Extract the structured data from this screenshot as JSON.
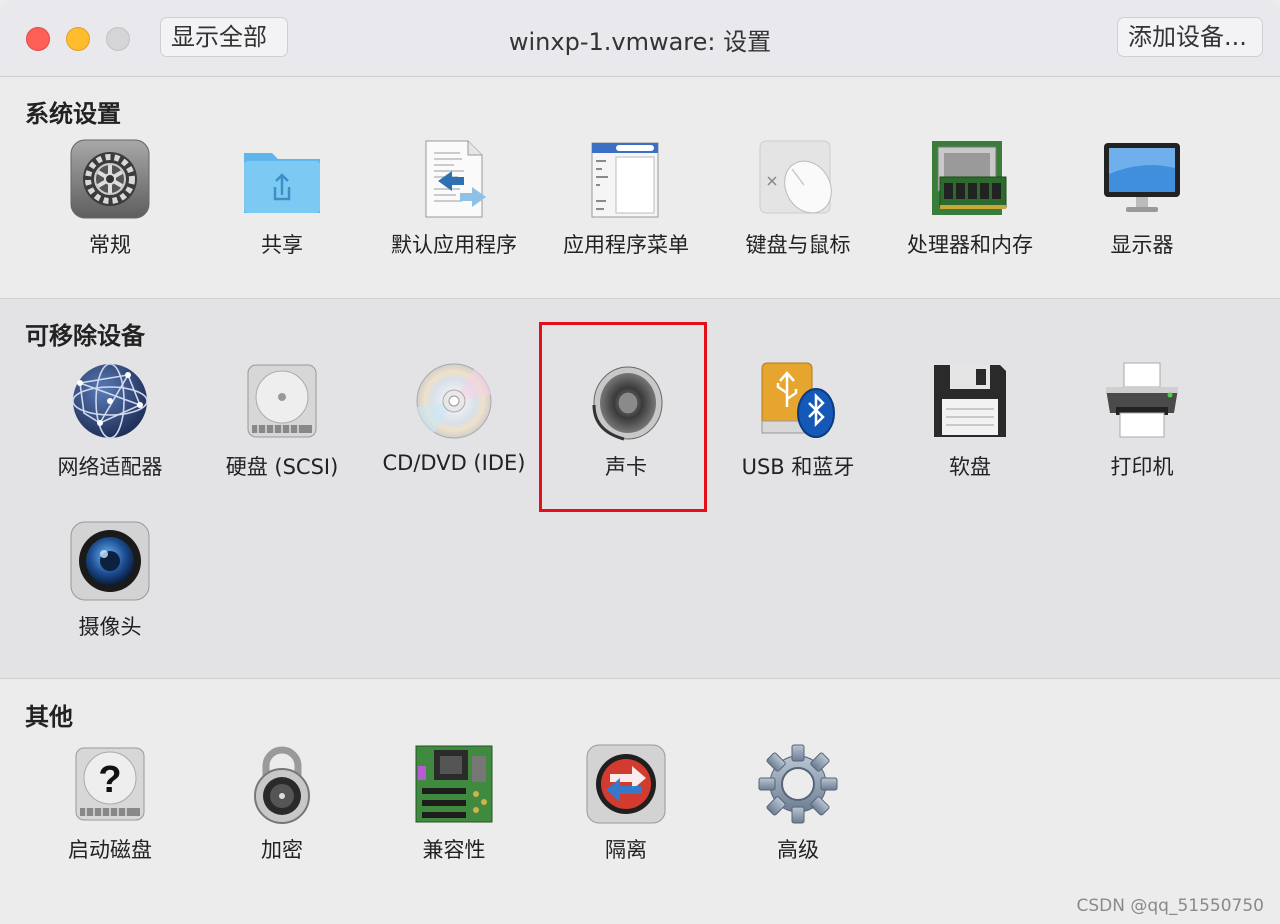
{
  "window": {
    "title": "winxp-1.vmware: 设置",
    "show_all_label": "显示全部",
    "add_device_label": "添加设备..."
  },
  "sections": {
    "system": {
      "title": "系统设置",
      "items": [
        {
          "label": "常规",
          "icon": "gear-icon"
        },
        {
          "label": "共享",
          "icon": "shared-folder-icon"
        },
        {
          "label": "默认应用程序",
          "icon": "default-apps-icon"
        },
        {
          "label": "应用程序菜单",
          "icon": "app-menu-icon"
        },
        {
          "label": "键盘与鼠标",
          "icon": "mouse-icon"
        },
        {
          "label": "处理器和内存",
          "icon": "memory-chip-icon"
        },
        {
          "label": "显示器",
          "icon": "monitor-icon"
        }
      ]
    },
    "removable": {
      "title": "可移除设备",
      "items": [
        {
          "label": "网络适配器",
          "icon": "network-globe-icon"
        },
        {
          "label": "硬盘 (SCSI)",
          "icon": "hard-disk-icon"
        },
        {
          "label": "CD/DVD (IDE)",
          "icon": "cd-dvd-icon"
        },
        {
          "label": "声卡",
          "icon": "speaker-icon"
        },
        {
          "label": "USB 和蓝牙",
          "icon": "usb-bluetooth-icon"
        },
        {
          "label": "软盘",
          "icon": "floppy-disk-icon"
        },
        {
          "label": "打印机",
          "icon": "printer-icon"
        },
        {
          "label": "摄像头",
          "icon": "camera-icon"
        }
      ]
    },
    "other": {
      "title": "其他",
      "items": [
        {
          "label": "启动磁盘",
          "icon": "startup-disk-icon"
        },
        {
          "label": "加密",
          "icon": "padlock-icon"
        },
        {
          "label": "兼容性",
          "icon": "motherboard-icon"
        },
        {
          "label": "隔离",
          "icon": "isolation-icon"
        },
        {
          "label": "高级",
          "icon": "advanced-gear-icon"
        }
      ]
    }
  },
  "watermark": "CSDN @qq_51550750",
  "colors": {
    "highlight": "#e3101a",
    "close": "#fe5f57",
    "minimize": "#febc2e"
  }
}
